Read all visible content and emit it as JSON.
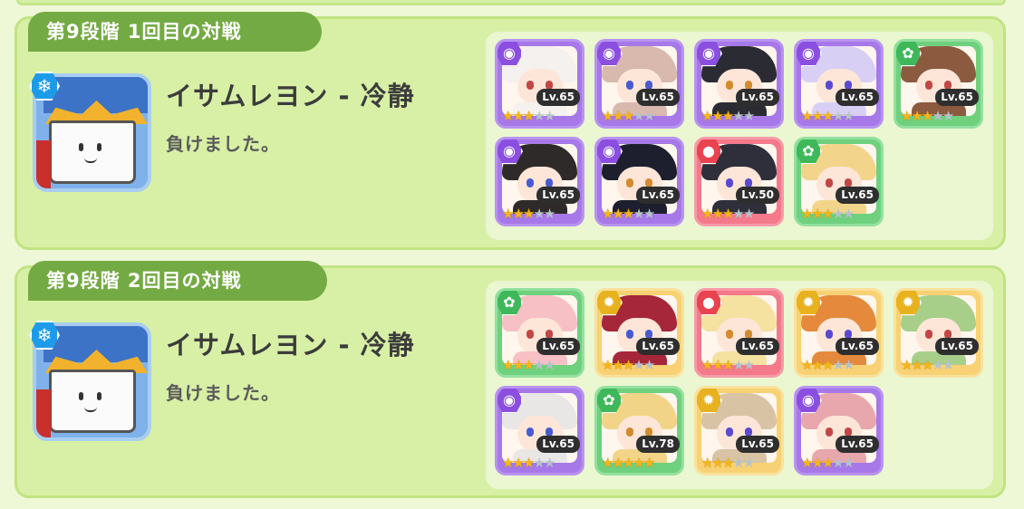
{
  "battles": [
    {
      "stage_title": "第9段階 1回目の対戦",
      "boss": {
        "name": "イサムレヨン - 冷静",
        "element_icon": "snowflake-icon"
      },
      "result": "負けました。",
      "units": [
        {
          "element": "dark",
          "level": "Lv.65",
          "stars": 3,
          "hair": "#f4f1ef"
        },
        {
          "element": "dark",
          "level": "Lv.65",
          "stars": 3,
          "hair": "#d9b8ae"
        },
        {
          "element": "dark",
          "level": "Lv.65",
          "stars": 3,
          "hair": "#2b2b33"
        },
        {
          "element": "dark",
          "level": "Lv.65",
          "stars": 3,
          "hair": "#d8d0f4"
        },
        {
          "element": "wind",
          "level": "Lv.65",
          "stars": 3,
          "hair": "#8c5a3f"
        },
        {
          "element": "dark",
          "level": "Lv.65",
          "stars": 3,
          "hair": "#2f2a2a"
        },
        {
          "element": "dark",
          "level": "Lv.65",
          "stars": 3,
          "hair": "#1d1f2e"
        },
        {
          "element": "fire",
          "level": "Lv.50",
          "stars": 3,
          "hair": "#2e2f3a"
        },
        {
          "element": "wind",
          "level": "Lv.65",
          "stars": 3,
          "hair": "#f2d58a"
        }
      ]
    },
    {
      "stage_title": "第9段階 2回目の対戦",
      "boss": {
        "name": "イサムレヨン - 冷静",
        "element_icon": "snowflake-icon"
      },
      "result": "負けました。",
      "units": [
        {
          "element": "wind",
          "level": "Lv.65",
          "stars": 3,
          "hair": "#f6c0c4"
        },
        {
          "element": "light",
          "level": "Lv.65",
          "stars": 3,
          "hair": "#a6263a"
        },
        {
          "element": "fire",
          "level": "Lv.65",
          "stars": 3,
          "hair": "#f5e1a0"
        },
        {
          "element": "light",
          "level": "Lv.65",
          "stars": 3,
          "hair": "#e58a3c"
        },
        {
          "element": "light",
          "level": "Lv.65",
          "stars": 3,
          "hair": "#a8cf8a"
        },
        {
          "element": "dark",
          "level": "Lv.65",
          "stars": 3,
          "hair": "#e9e6e6"
        },
        {
          "element": "wind",
          "level": "Lv.78",
          "stars": 5,
          "hair": "#f1d487"
        },
        {
          "element": "light",
          "level": "Lv.65",
          "stars": 3,
          "hair": "#d8c3a5"
        },
        {
          "element": "dark",
          "level": "Lv.65",
          "stars": 3,
          "hair": "#e7a7ad"
        }
      ]
    }
  ],
  "max_stars": 5,
  "element_colors": {
    "dark": "purple",
    "wind": "green",
    "fire": "red",
    "light": "yellow"
  },
  "element_glyphs": {
    "dark": "◉",
    "wind": "✿",
    "fire": "●",
    "light": "✹"
  }
}
